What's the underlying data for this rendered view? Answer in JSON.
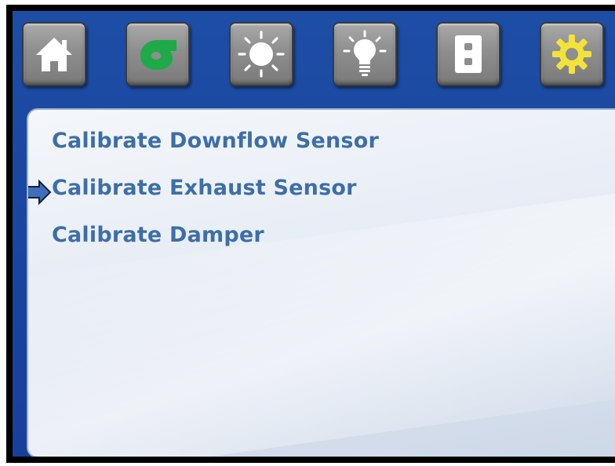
{
  "toolbar": {
    "buttons": [
      {
        "name": "home",
        "icon": "home-icon",
        "icon_color": "#ffffff"
      },
      {
        "name": "blower",
        "icon": "blower-fan-icon",
        "icon_color": "#1faa4a"
      },
      {
        "name": "sun",
        "icon": "sun-icon",
        "icon_color": "#ffffff"
      },
      {
        "name": "light",
        "icon": "light-bulb-icon",
        "icon_color": "#ffffff"
      },
      {
        "name": "outlet",
        "icon": "outlet-icon",
        "icon_color": "#ffffff"
      },
      {
        "name": "settings",
        "icon": "gear-icon",
        "icon_color": "#f2e33a"
      }
    ]
  },
  "menu": {
    "items": [
      {
        "label": "Calibrate Downflow Sensor",
        "selected": false
      },
      {
        "label": "Calibrate Exhaust Sensor",
        "selected": true
      },
      {
        "label": "Calibrate Damper",
        "selected": false
      }
    ],
    "pointer_icon": "right-arrow-icon"
  },
  "colors": {
    "background": "#1b49a1",
    "menu_text": "#3d6ea7",
    "pointer": "#3f6fb8"
  }
}
